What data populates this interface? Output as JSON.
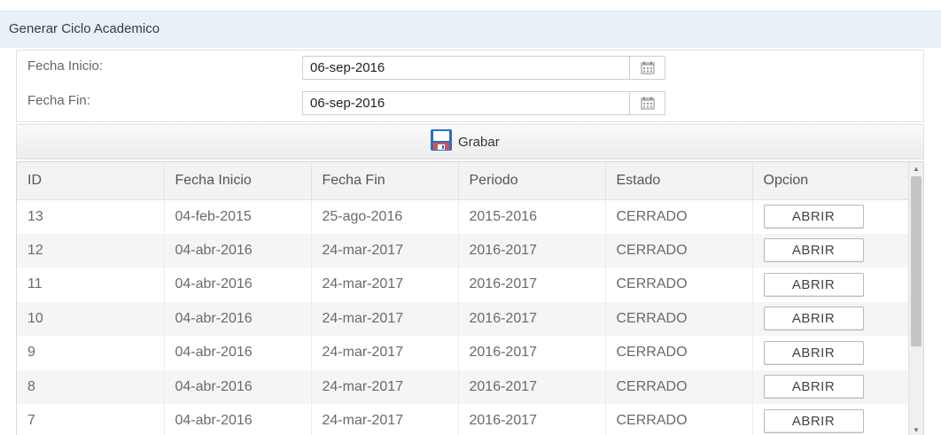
{
  "header": {
    "title": "Generar Ciclo Academico"
  },
  "form": {
    "fecha_inicio_label": "Fecha Inicio:",
    "fecha_inicio_value": "06-sep-2016",
    "fecha_fin_label": "Fecha Fin:",
    "fecha_fin_value": "06-sep-2016",
    "calendar_icon": "calendar-icon"
  },
  "toolbar": {
    "save_label": "Grabar",
    "save_icon": "floppy-disk-icon"
  },
  "table": {
    "columns": [
      "ID",
      "Fecha Inicio",
      "Fecha Fin",
      "Periodo",
      "Estado",
      "Opcion"
    ],
    "rows": [
      {
        "id": "13",
        "fecha_inicio": "04-feb-2015",
        "fecha_fin": "25-ago-2016",
        "periodo": "2015-2016",
        "estado": "CERRADO",
        "opcion": "ABRIR"
      },
      {
        "id": "12",
        "fecha_inicio": "04-abr-2016",
        "fecha_fin": "24-mar-2017",
        "periodo": "2016-2017",
        "estado": "CERRADO",
        "opcion": "ABRIR"
      },
      {
        "id": "11",
        "fecha_inicio": "04-abr-2016",
        "fecha_fin": "24-mar-2017",
        "periodo": "2016-2017",
        "estado": "CERRADO",
        "opcion": "ABRIR"
      },
      {
        "id": "10",
        "fecha_inicio": "04-abr-2016",
        "fecha_fin": "24-mar-2017",
        "periodo": "2016-2017",
        "estado": "CERRADO",
        "opcion": "ABRIR"
      },
      {
        "id": "9",
        "fecha_inicio": "04-abr-2016",
        "fecha_fin": "24-mar-2017",
        "periodo": "2016-2017",
        "estado": "CERRADO",
        "opcion": "ABRIR"
      },
      {
        "id": "8",
        "fecha_inicio": "04-abr-2016",
        "fecha_fin": "24-mar-2017",
        "periodo": "2016-2017",
        "estado": "CERRADO",
        "opcion": "ABRIR"
      },
      {
        "id": "7",
        "fecha_inicio": "04-abr-2016",
        "fecha_fin": "24-mar-2017",
        "periodo": "2016-2017",
        "estado": "CERRADO",
        "opcion": "ABRIR"
      }
    ]
  },
  "colors": {
    "header_bg": "#e8f0f8",
    "alt_row": "#f5f5f5",
    "save_icon_blue": "#2a6fc0",
    "save_icon_red": "#d9534f"
  }
}
